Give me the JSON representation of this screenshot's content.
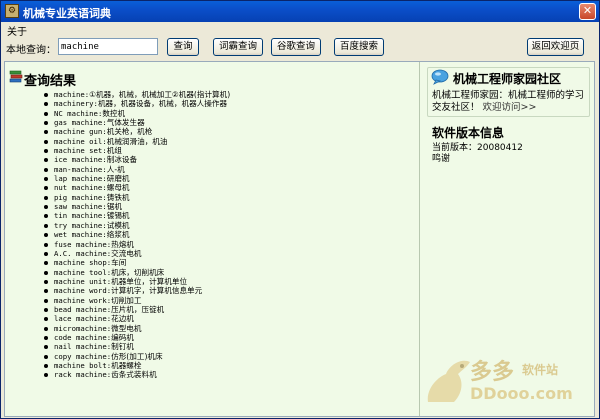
{
  "window": {
    "title": "机械专业英语词典",
    "close_glyph": "✕"
  },
  "menu": {
    "about": "关于"
  },
  "toolbar": {
    "search_label": "本地查询：",
    "search_value": "machine",
    "buttons": {
      "query": "查询",
      "iciba": "词霸查询",
      "google": "谷歌查询",
      "baidu": "百度搜索",
      "home": "返回欢迎页"
    }
  },
  "results": {
    "title": "查询结果",
    "items": [
      {
        "term": "machine",
        "def": "①机器，机械，机械加工②机器(指计算机)"
      },
      {
        "term": "machinery",
        "def": "机器，机器设备，机械，机器人操作器"
      },
      {
        "term": "NC machine",
        "def": "数控机"
      },
      {
        "term": "gas machine",
        "def": "气体发生器"
      },
      {
        "term": "machine gun",
        "def": "机关枪，机枪"
      },
      {
        "term": "machine oil",
        "def": "机械润滑油，机油"
      },
      {
        "term": "machine set",
        "def": "机组"
      },
      {
        "term": "ice machine",
        "def": "制冰设备"
      },
      {
        "term": "man-machine",
        "def": "人-机"
      },
      {
        "term": "lap machine",
        "def": "研磨机"
      },
      {
        "term": "nut machine",
        "def": "螺母机"
      },
      {
        "term": "pig machine",
        "def": "铸铁机"
      },
      {
        "term": "saw machine",
        "def": "锯机"
      },
      {
        "term": "tin machine",
        "def": "镀锡机"
      },
      {
        "term": "try machine",
        "def": "试模机"
      },
      {
        "term": "wet machine",
        "def": "络浆机"
      },
      {
        "term": "fuse machine",
        "def": "热熔机"
      },
      {
        "term": "A.C. machine",
        "def": "交流电机"
      },
      {
        "term": "machine shop",
        "def": "车间"
      },
      {
        "term": "machine tool",
        "def": "机床，切削机床"
      },
      {
        "term": "machine unit",
        "def": "机器单位，计算机单位"
      },
      {
        "term": "machine word",
        "def": "计算机字，计算机信息单元"
      },
      {
        "term": "machine work",
        "def": "切削加工"
      },
      {
        "term": "bead machine",
        "def": "压片机，压锭机"
      },
      {
        "term": "lace machine",
        "def": "花边机"
      },
      {
        "term": "micromachine",
        "def": "微型电机"
      },
      {
        "term": "code machine",
        "def": "编码机"
      },
      {
        "term": "nail machine",
        "def": "制钉机"
      },
      {
        "term": "copy machine",
        "def": "仿形(加工)机床"
      },
      {
        "term": "machine bolt",
        "def": "机器螺栓"
      },
      {
        "term": "rack machine",
        "def": "齿条式装料机"
      }
    ]
  },
  "sidebar": {
    "community_title": "机械工程师家园社区",
    "community_desc": "机械工程师家园：机械工程师的学习交友社区！",
    "visit_link": "欢迎访问>>",
    "version_title": "软件版本信息",
    "version_label": "当前版本：",
    "version_value": "20080412",
    "thanks": "鸣谢"
  },
  "watermark": {
    "brand": "多多",
    "subtitle": "软件站",
    "url": "DDooo.com"
  },
  "colors": {
    "titlebar": "#0b4ec9",
    "content_bg": "#f0fae7",
    "chrome": "#ece9d8"
  },
  "icons": {
    "app": "app-icon",
    "book": "book-icon",
    "bubble": "speech-bubble-icon",
    "close": "close-icon"
  }
}
